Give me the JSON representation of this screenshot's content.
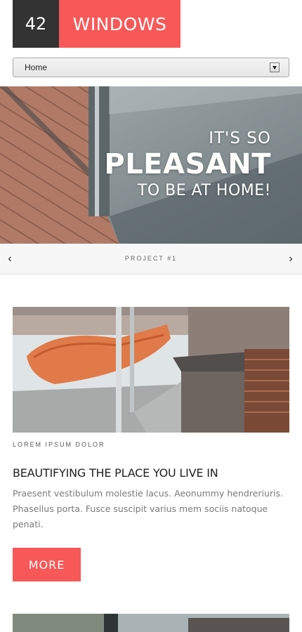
{
  "logo": {
    "number": "42",
    "name": "WINDOWS"
  },
  "nav": {
    "selected": "Home"
  },
  "hero": {
    "line1": "IT'S SO",
    "line2": "PLEASANT",
    "line3": "TO BE AT HOME!",
    "caption": "PROJECT #1",
    "prev_icon": "‹",
    "next_icon": "›"
  },
  "article": {
    "meta": "LOREM IPSUM DOLOR",
    "title": "BEAUTIFYING THE PLACE YOU LIVE IN",
    "body": "Praesent vestibulum molestie lacus. Aeonummy hendreriuris. Phasellus porta. Fusce suscipit varius mem sociis natoque penati.",
    "button": "MORE"
  },
  "colors": {
    "accent": "#f85858",
    "dark": "#333333"
  }
}
